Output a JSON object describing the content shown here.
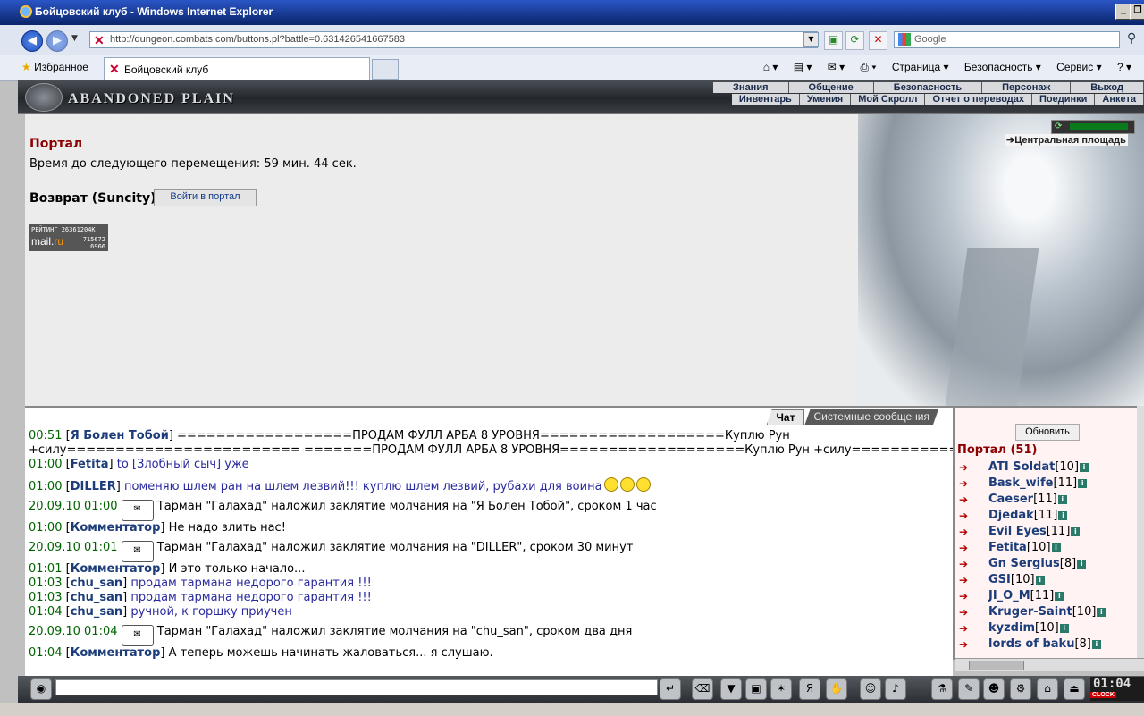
{
  "browser": {
    "title": "Бойцовский клуб - Windows Internet Explorer",
    "url": "http://dungeon.combats.com/buttons.pl?battle=0.631426541667583",
    "search_placeholder": "Google",
    "favorites_label": "Избранное",
    "tab_title": "Бойцовский клуб",
    "commands": [
      "Страница ▾",
      "Безопасность ▾",
      "Сервис ▾"
    ]
  },
  "game": {
    "logo": "ABANDONED PLAIN",
    "menu_top": [
      "Знания",
      "Общение",
      "Безопасность",
      "Персонаж",
      "Выход"
    ],
    "menu_bottom": [
      "Инвентарь",
      "Умения",
      "Мой Скролл",
      "Отчет о переводах",
      "Поединки",
      "Анкета"
    ]
  },
  "main": {
    "portal_title": "Портал",
    "timer_text": "Время до следующего перемещения: 59 мин. 44 сек.",
    "return_label": "Возврат (Suncity)",
    "portal_button": "Войти в портал",
    "central_link": "➔Центральная площадь",
    "energy_fraction": 0.95,
    "counter": {
      "line1": "РЕЙТИНГ 26361204К",
      "brand_a": "mail.",
      "brand_b": "ru",
      "num1": "715672",
      "num2": "6966"
    }
  },
  "chat": {
    "tabs": [
      "Чат",
      "Системные сообщения"
    ],
    "messages": [
      {
        "time": "00:51",
        "nick": "Я Болен Тобой",
        "text": "==================ПРОДАМ ФУЛЛ АРБА 8 УРОВНЯ===================Куплю Рун",
        "style": "plain"
      },
      {
        "time": "",
        "nick": "",
        "text": "+силу======================== =======ПРОДАМ ФУЛЛ АРБА 8 УРОВНЯ===================Куплю Рун +силу==============",
        "style": "plain"
      },
      {
        "time": "01:00",
        "nick": "Fetita",
        "text": "to [Злобный сыч] уже",
        "style": "purple"
      },
      {
        "time": "01:00",
        "nick": "DILLER",
        "text": "поменяю шлем ран на шлем лезвий!!! куплю шлем лезвий, рубахи для воина",
        "style": "purple",
        "smileys": 3
      },
      {
        "time": "20.09.10 01:00",
        "nick": "",
        "text": "Тарман \"Галахад\" наложил заклятие молчания на \"Я Болен Тобой\", сроком 1 час",
        "style": "system"
      },
      {
        "time": "01:00",
        "nick": "Комментатор",
        "text": "Не надо злить нас!",
        "style": "plain"
      },
      {
        "time": "20.09.10 01:01",
        "nick": "",
        "text": "Тарман \"Галахад\" наложил заклятие молчания на \"DILLER\", сроком 30 минут",
        "style": "system"
      },
      {
        "time": "01:01",
        "nick": "Комментатор",
        "text": "И это только начало...",
        "style": "plain"
      },
      {
        "time": "01:03",
        "nick": "chu_san",
        "text": "продам тармана недорого гарантия !!!",
        "style": "purple"
      },
      {
        "time": "01:03",
        "nick": "chu_san",
        "text": "продам тармана недорого гарантия !!!",
        "style": "purple"
      },
      {
        "time": "01:04",
        "nick": "chu_san",
        "text": "ручной, к горшку приучен",
        "style": "purple"
      },
      {
        "time": "20.09.10 01:04",
        "nick": "",
        "text": "Тарман \"Галахад\" наложил заклятие молчания на \"chu_san\", сроком два дня",
        "style": "system"
      },
      {
        "time": "01:04",
        "nick": "Комментатор",
        "text": "А теперь можешь начинать жаловаться... я слушаю.",
        "style": "plain"
      }
    ]
  },
  "online": {
    "refresh_label": "Обновить",
    "title": "Портал (51)",
    "users": [
      {
        "name": "ATI Soldat",
        "level": "[10]"
      },
      {
        "name": "Bask_wife",
        "level": "[11]"
      },
      {
        "name": "Caeser",
        "level": "[11]"
      },
      {
        "name": "Djedak",
        "level": "[11]"
      },
      {
        "name": "Evil Eyes",
        "level": "[11]"
      },
      {
        "name": "Fetita",
        "level": "[10]"
      },
      {
        "name": "Gn Sergius",
        "level": "[8]"
      },
      {
        "name": "GSI",
        "level": "[10]"
      },
      {
        "name": "JI_O_M",
        "level": "[11]"
      },
      {
        "name": "Kruger-Saint",
        "level": "[10]"
      },
      {
        "name": "kyzdim",
        "level": "[10]"
      },
      {
        "name": "lords of baku",
        "level": "[8]"
      }
    ]
  },
  "clock": {
    "time": "01:04",
    "label": "CLOCK"
  }
}
